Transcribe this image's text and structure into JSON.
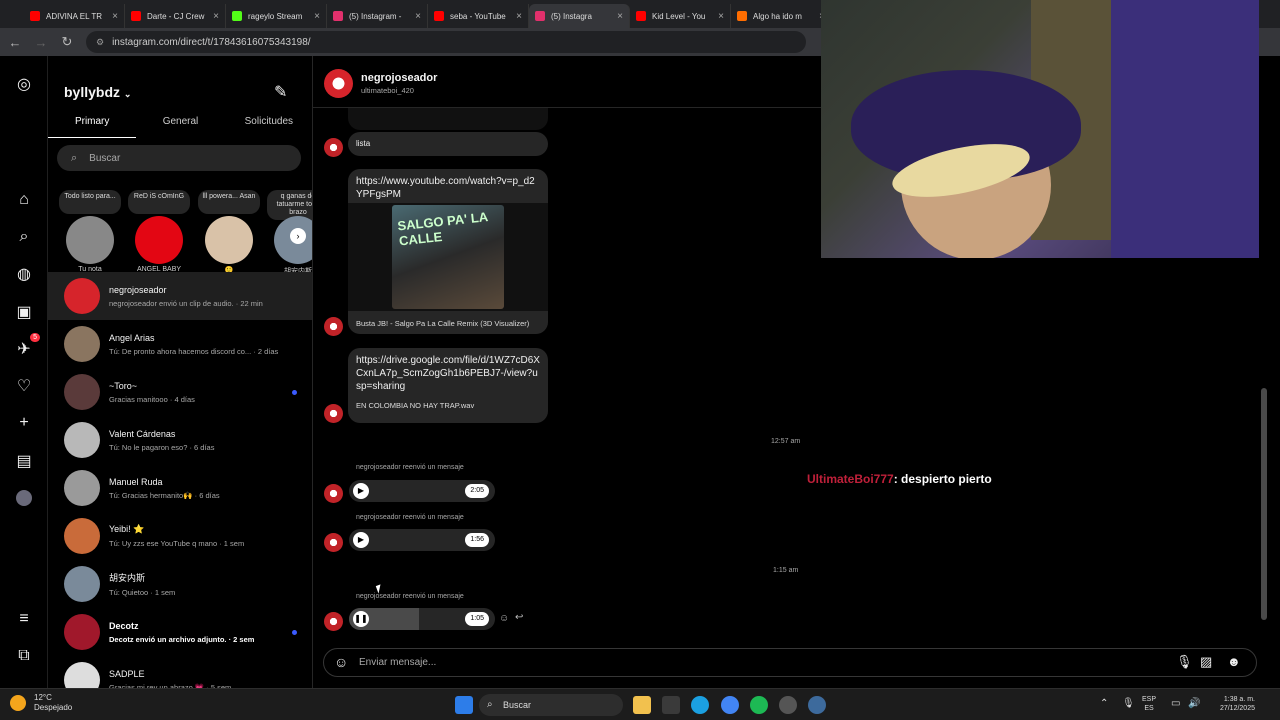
{
  "browser": {
    "tabs": [
      {
        "title": "ADIVINA EL TR",
        "color": "#ff0000"
      },
      {
        "title": "Darte - CJ Crew",
        "color": "#ff0000"
      },
      {
        "title": "rageylo Stream",
        "color": "#53fc18"
      },
      {
        "title": "(5) Instagram -",
        "color": "#e1306c"
      },
      {
        "title": "seba - YouTube",
        "color": "#ff0000"
      },
      {
        "title": "(5) Instagra",
        "color": "#e1306c"
      },
      {
        "title": "Kid Level - You",
        "color": "#ff0000"
      },
      {
        "title": "Algo ha ido m",
        "color": "#ff6d00"
      }
    ],
    "url": "instagram.com/direct/t/17843616075343198/"
  },
  "sidebar": {
    "account": "byllybdz",
    "tabs": [
      "Primary",
      "General",
      "Solicitudes"
    ],
    "search_placeholder": "Buscar",
    "notes": [
      {
        "bubble": "Todo listo para...",
        "name": "Tu nota",
        "color": "#888888"
      },
      {
        "bubble": "ReD iS cOmInG",
        "name": "ANGEL BABY",
        "color": "#e30613"
      },
      {
        "bubble": "lll powera... Asan",
        "name": "🙂",
        "color": "#d9c2a8"
      },
      {
        "bubble": "q ganas de tatuarme to el brazo",
        "name": "胡安内斯",
        "color": "#7a8a9a"
      }
    ],
    "rail_badge": "5",
    "conversations": [
      {
        "name": "negrojoseador",
        "preview": "negrojoseador envió un clip de audio. · 22 min",
        "color": "#d6242b",
        "selected": true
      },
      {
        "name": "Angel Arias",
        "preview": "Tú: De pronto ahora hacemos discord co... · 2 días",
        "color": "#8a7560"
      },
      {
        "name": "~Toro~",
        "preview": "Gracias manitooo · 4 días",
        "color": "#5a3a3a",
        "unread_dot": true
      },
      {
        "name": "Valent Cárdenas",
        "preview": "Tú: No le pagaron eso? · 6 días",
        "color": "#b8b8b8"
      },
      {
        "name": "Manuel Ruda",
        "preview": "Tú: Gracias hermanito🙌 · 6 días",
        "color": "#9a9a9a"
      },
      {
        "name": "Yeibi! ⭐",
        "preview": "Tú: Uy zzs ese YouTube q mano · 1 sem",
        "color": "#c96b3a"
      },
      {
        "name": "胡安内斯",
        "preview": "Tú: Quietoo · 1 sem",
        "color": "#7a8a9a"
      },
      {
        "name": "Decotz",
        "preview": "Decotz envió un archivo adjunto. · 2 sem",
        "color": "#a0182b",
        "unread": true
      },
      {
        "name": "SADPLE",
        "preview": "Gracias mi rey un abrazo 💗 · 5 sem",
        "color": "#dddddd"
      }
    ]
  },
  "chat": {
    "header_name": "negrojoseador",
    "header_sub": "ultimateboi_420",
    "msg_lista": "lista",
    "link1": "https://www.youtube.com/watch?v=p_d2YPFgsPM",
    "thumb_text": "SALGO PA' LA CALLE",
    "link1_caption": "Busta JB! - Salgo Pa La Calle Remix (3D Visualizer)",
    "link2": "https://drive.google.com/file/d/1WZ7cD6XCxnLA7p_ScmZogGh1b6PEBJ7-/view?usp=sharing",
    "link2_caption": "EN COLOMBIA NO HAY TRAP.wav",
    "time1": "12:57 am",
    "fwd_label": "negrojoseador reenvió un mensaje",
    "audio1_dur": "2:05",
    "audio2_dur": "1:56",
    "time2": "1:15 am",
    "audio3_dur": "1:05",
    "audio3_progress": 0.48,
    "composer_placeholder": "Enviar mensaje..."
  },
  "overlay": {
    "user": "UltimateBoi777",
    "message": ": despierto pierto"
  },
  "taskbar": {
    "temp": "12°C",
    "weather": "Despejado",
    "search": "Buscar",
    "lang1": "ESP",
    "lang2": "ES",
    "time": "1:38 a. m.",
    "date": "27/12/2025"
  }
}
